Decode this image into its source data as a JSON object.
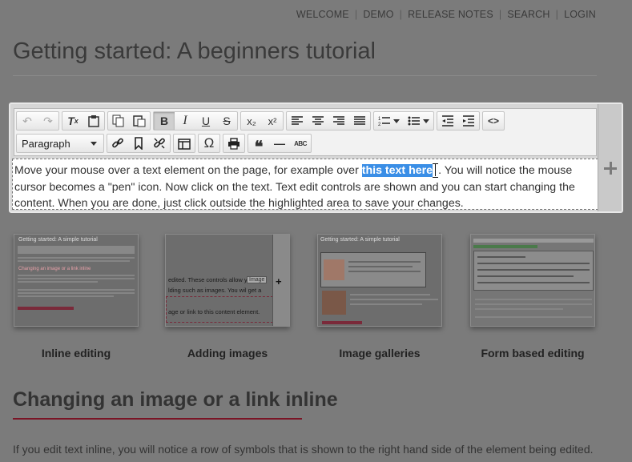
{
  "nav": {
    "items": [
      "WELCOME",
      "DEMO",
      "RELEASE NOTES",
      "SEARCH",
      "LOGIN"
    ]
  },
  "page": {
    "title": "Getting started: A beginners tutorial"
  },
  "editor": {
    "format_select": "Paragraph",
    "content": {
      "before": "Move your mouse over a text element on the page, for example over ",
      "highlight": "this text here",
      "after": ". You will notice the mouse cursor becomes a \"pen\" icon. Now click on the text. Text edit controls are shown and you can start changing the content. When you are done, just click outside the highlighted area to save your changes."
    },
    "toolbar_icons": {
      "undo": "↶",
      "redo": "↷",
      "clear": "T̸",
      "paste": "📋",
      "copy": "⧉",
      "paste_text": "❐",
      "bold": "B",
      "italic": "I",
      "underline": "U",
      "strike": "S",
      "subscript": "x₂",
      "superscript": "x²",
      "align_left": "≡",
      "align_center": "≡",
      "align_right": "≡",
      "justify": "≡",
      "numbered": "⒈",
      "bullets": "☰",
      "outdent": "⇤",
      "indent": "⇥",
      "code": "<>",
      "link": "🔗",
      "bookmark": "🔖",
      "unlink": "⛓",
      "template": "▤",
      "omega": "Ω",
      "print": "⎙",
      "quote": "❝",
      "hr": "—",
      "spell": "ABC"
    }
  },
  "thumbnails": [
    {
      "caption": "Inline editing",
      "title": "Getting started: A simple tutorial",
      "sub": "Changing an image or a link inline"
    },
    {
      "caption": "Adding images",
      "text1": "edited. These controls allow y",
      "text2": "lding such as images. You wil get a",
      "text3": "age or link to this content element.",
      "tag": "Image"
    },
    {
      "caption": "Image galleries",
      "title": "Getting started: A simple tutorial"
    },
    {
      "caption": "Form based editing"
    }
  ],
  "section": {
    "title": "Changing an image or a link inline",
    "body": "If you edit text inline, you will notice a row of symbols that is shown to the right hand side of the element being edited."
  }
}
